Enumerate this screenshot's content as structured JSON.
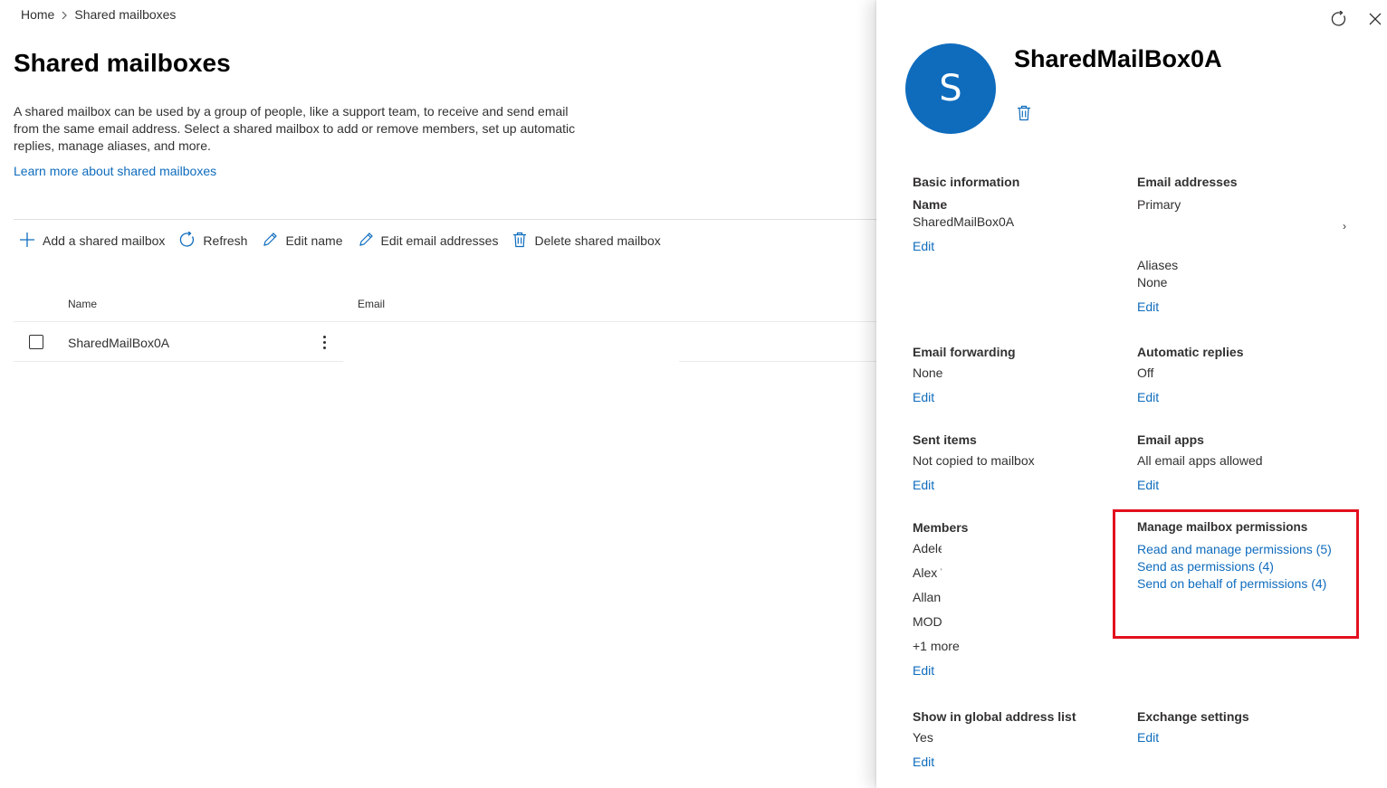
{
  "breadcrumb": {
    "home": "Home",
    "current": "Shared mailboxes"
  },
  "page": {
    "title": "Shared mailboxes",
    "description": "A shared mailbox can be used by a group of people, like a support team, to receive and send email from the same email address. Select a shared mailbox to add or remove members, set up automatic replies, manage aliases, and more.",
    "learn_more": "Learn more about shared mailboxes"
  },
  "toolbar": {
    "add": "Add a shared mailbox",
    "refresh": "Refresh",
    "edit_name": "Edit name",
    "edit_email": "Edit email addresses",
    "delete": "Delete shared mailbox"
  },
  "table": {
    "columns": {
      "name": "Name",
      "email": "Email"
    },
    "rows": [
      {
        "name": "SharedMailBox0A"
      }
    ]
  },
  "panel": {
    "avatar_initial": "S",
    "title": "SharedMailBox0A",
    "basic_info": {
      "title": "Basic information",
      "name_label": "Name",
      "name_value": "SharedMailBox0A",
      "edit": "Edit"
    },
    "email_addresses": {
      "title": "Email addresses",
      "primary_label": "Primary",
      "aliases_label": "Aliases",
      "aliases_value": "None",
      "edit": "Edit"
    },
    "email_forwarding": {
      "title": "Email forwarding",
      "value": "None",
      "edit": "Edit"
    },
    "automatic_replies": {
      "title": "Automatic replies",
      "value": "Off",
      "edit": "Edit"
    },
    "sent_items": {
      "title": "Sent items",
      "value": "Not copied to mailbox",
      "edit": "Edit"
    },
    "email_apps": {
      "title": "Email apps",
      "value": "All email apps allowed",
      "edit": "Edit"
    },
    "members": {
      "title": "Members",
      "items": [
        "Adele",
        "Alex W",
        "Allan",
        "MOD"
      ],
      "more": "+1 more",
      "edit": "Edit"
    },
    "permissions": {
      "title": "Manage mailbox permissions",
      "read_manage": "Read and manage permissions (5)",
      "send_as": "Send as permissions (4)",
      "send_on_behalf": "Send on behalf of permissions (4)"
    },
    "global_address": {
      "title": "Show in global address list",
      "value": "Yes",
      "edit": "Edit"
    },
    "exchange_settings": {
      "title": "Exchange settings",
      "edit": "Edit"
    }
  },
  "colors": {
    "accent": "#0f6cbd",
    "highlight": "#e3101e",
    "text": "#323130"
  }
}
